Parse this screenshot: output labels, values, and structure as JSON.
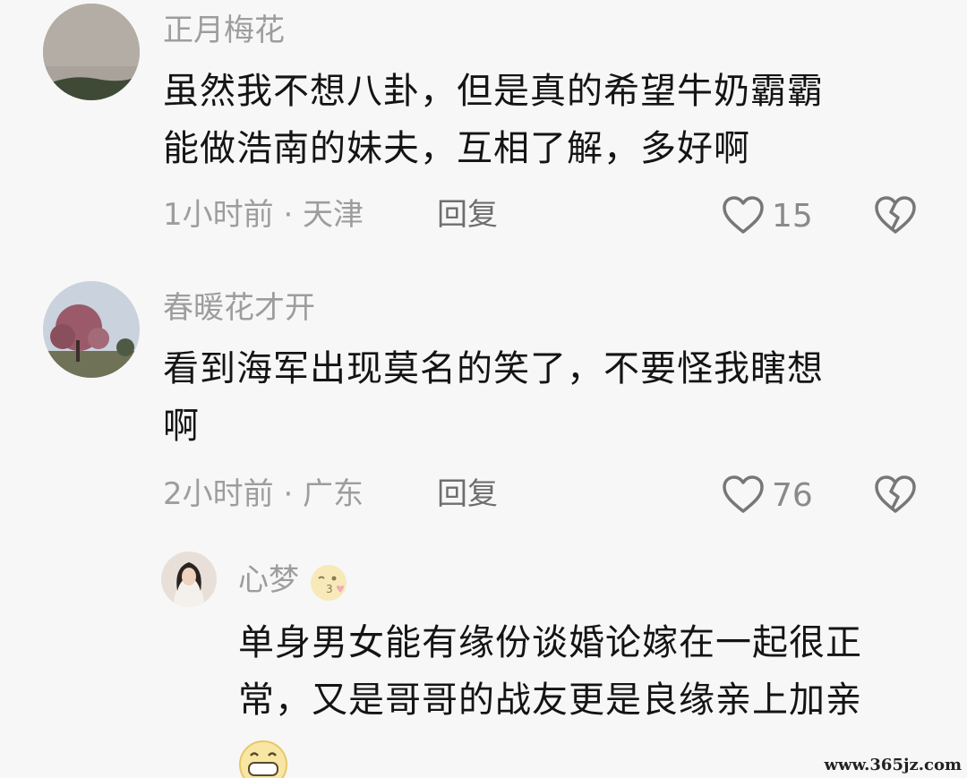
{
  "comments": [
    {
      "username": "正月梅花",
      "lines": [
        "虽然我不想八卦，但是真的希望牛奶霸霸",
        "能做浩南的妹夫，互相了解，多好啊"
      ],
      "meta": "1小时前 · 天津",
      "reply_label": "回复",
      "likes": "15"
    },
    {
      "username": "春暖花才开",
      "lines": [
        "看到海军出现莫名的笑了，不要怪我瞎想",
        "啊"
      ],
      "meta": "2小时前 · 广东",
      "reply_label": "回复",
      "likes": "76"
    }
  ],
  "reply": {
    "username": "心梦",
    "lines": [
      "单身男女能有缘份谈婚论嫁在一起很正",
      "常，又是哥哥的战友更是良缘亲上加亲"
    ]
  },
  "icons": {
    "like": "heart-outline-icon",
    "dislike": "broken-heart-icon",
    "username_emoji": "wink-kiss-emoji-icon",
    "content_emoji": "grin-emoji-icon"
  },
  "watermark": "www.365jz.com"
}
